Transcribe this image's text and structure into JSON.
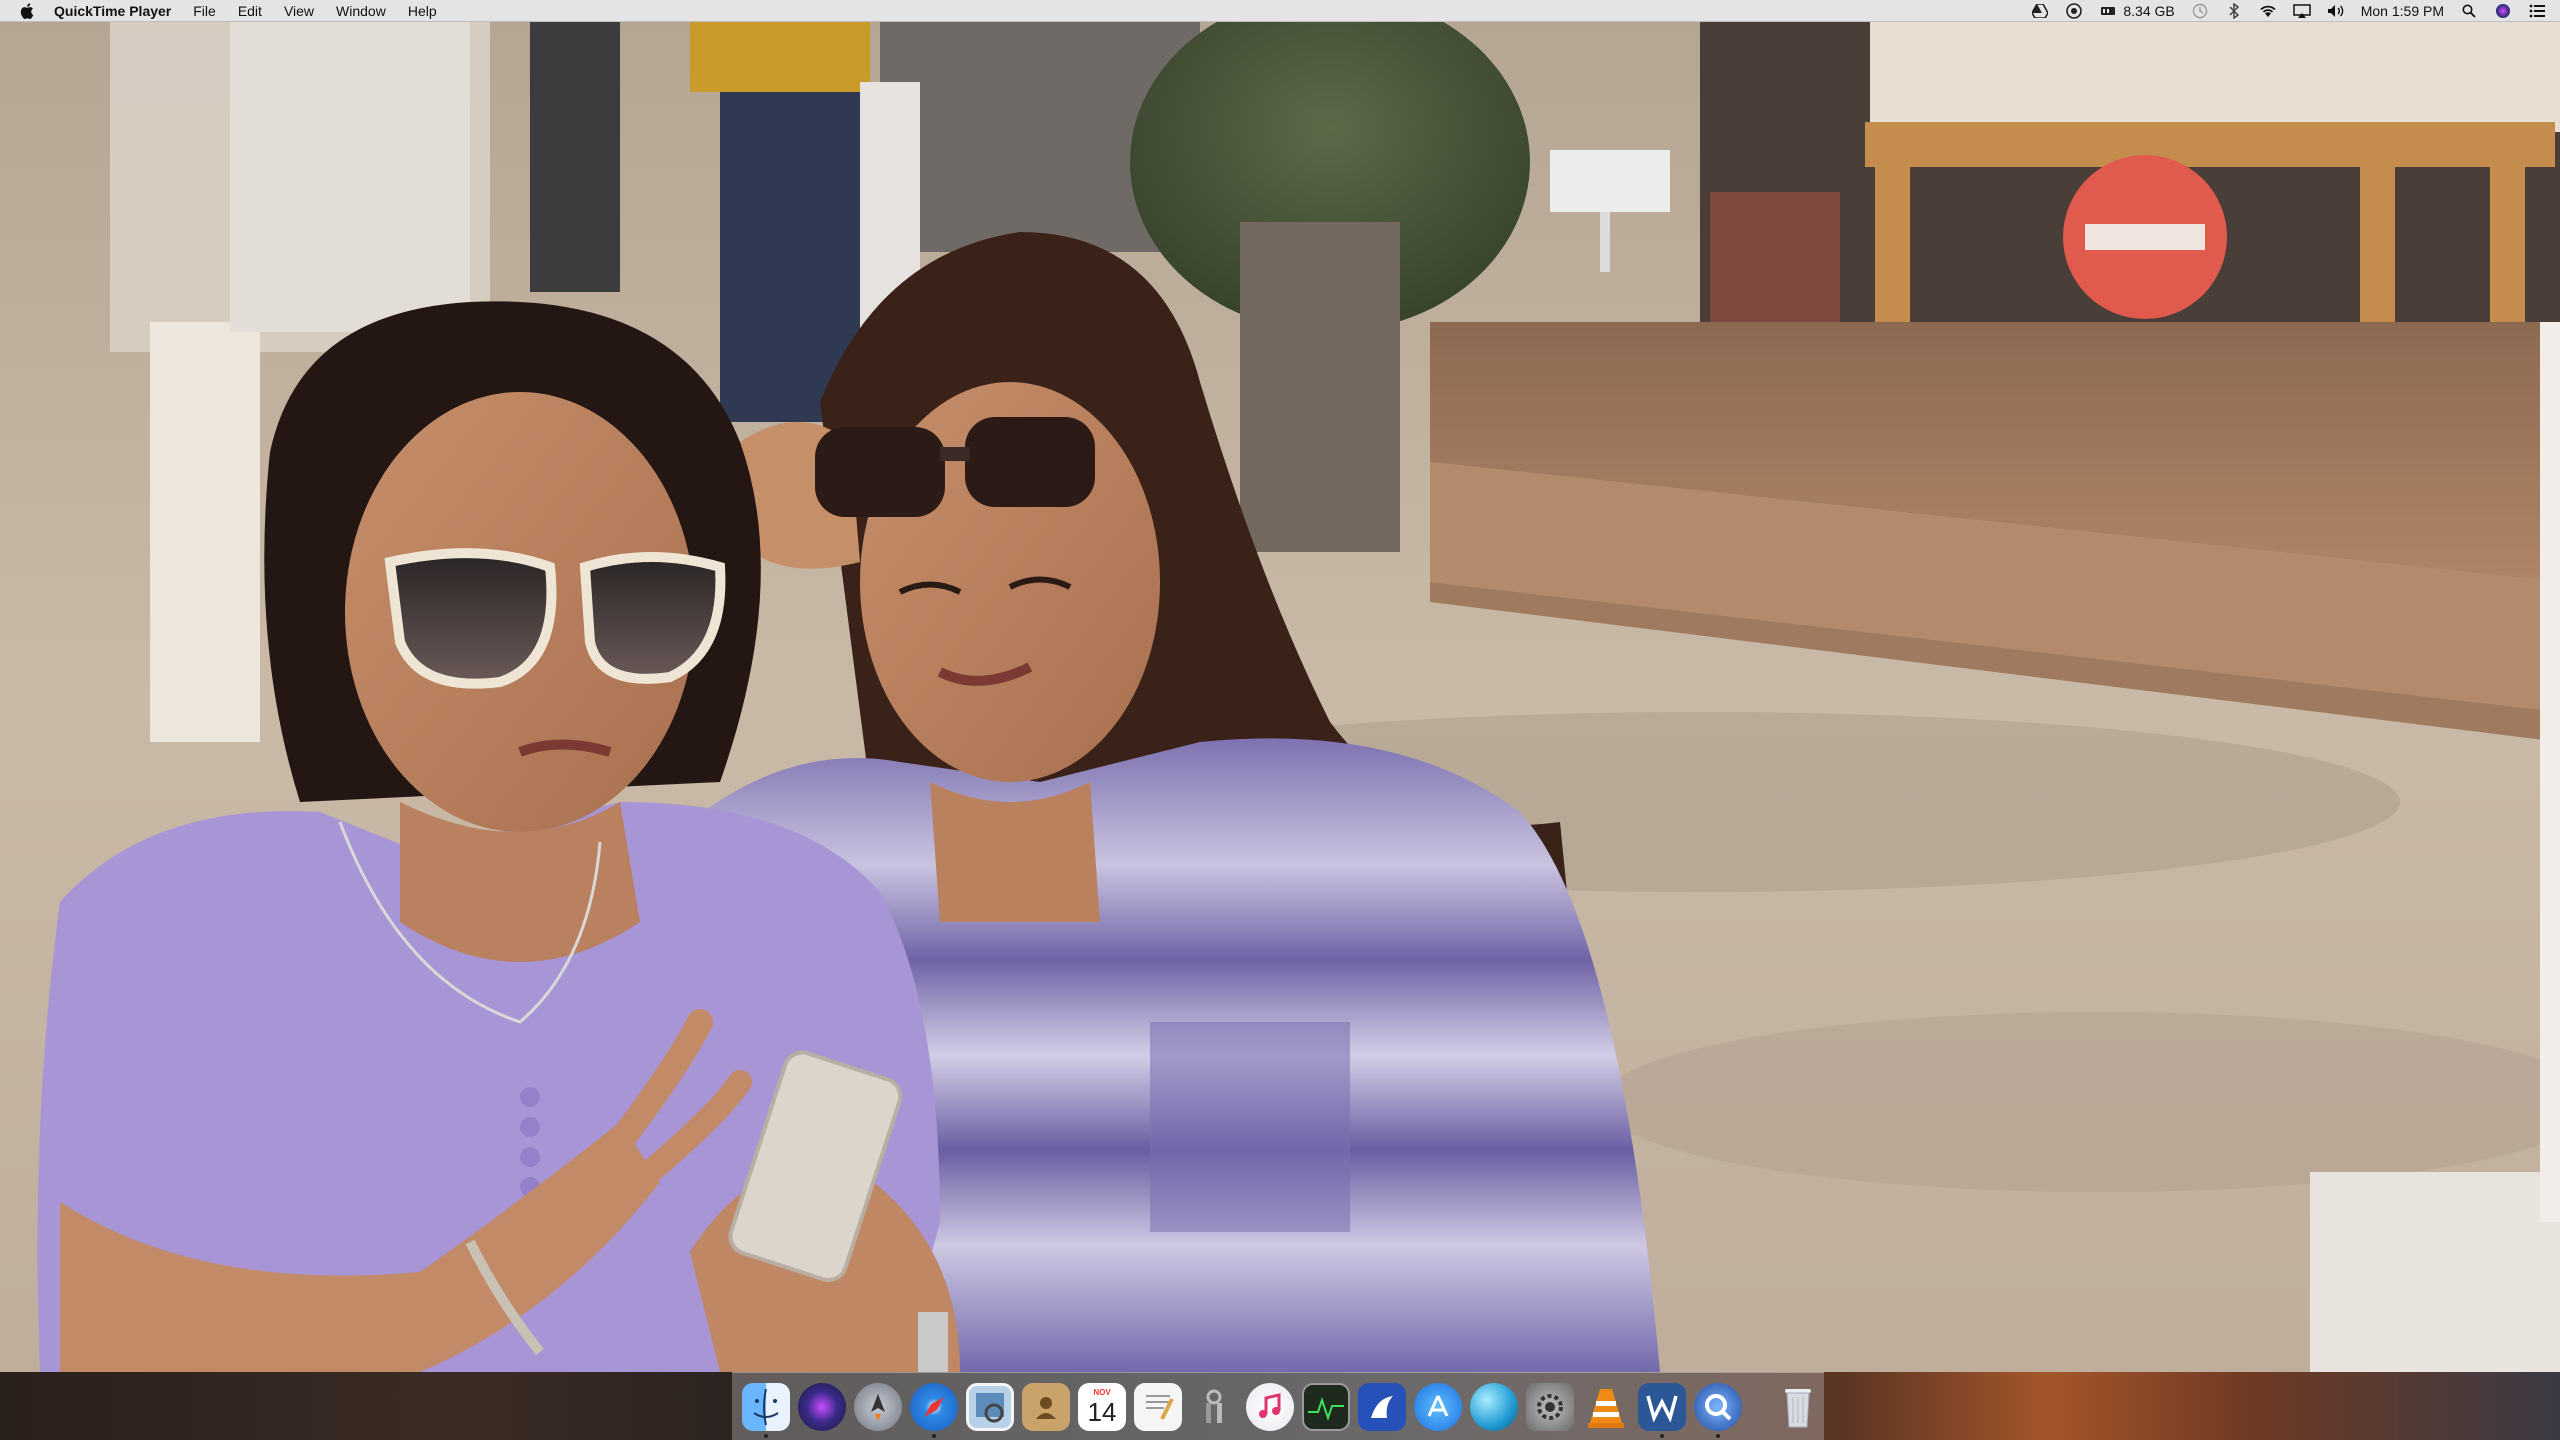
{
  "menubar": {
    "app_name": "QuickTime Player",
    "menus": [
      "File",
      "Edit",
      "View",
      "Window",
      "Help"
    ],
    "status": {
      "storage": "8.34 GB",
      "clock": "Mon 1:59 PM"
    },
    "icons": [
      "apple-icon",
      "google-drive-icon",
      "app-status-icon",
      "memory-icon",
      "time-machine-icon",
      "bluetooth-icon",
      "wifi-icon",
      "airplay-icon",
      "volume-icon",
      "spotlight-icon",
      "siri-icon",
      "notification-center-icon"
    ]
  },
  "calendar_icon": {
    "month": "NOV",
    "day": "14"
  },
  "dock": {
    "apps": [
      {
        "name": "finder",
        "color": "#3d8ff5",
        "running": true
      },
      {
        "name": "siri",
        "color": "#2b2b55",
        "running": false
      },
      {
        "name": "launchpad",
        "color": "#9aa0aa",
        "running": false
      },
      {
        "name": "safari",
        "color": "#2f8ae6",
        "running": true
      },
      {
        "name": "preview",
        "color": "#88b4d8",
        "running": false
      },
      {
        "name": "contacts",
        "color": "#c9a36a",
        "running": false
      },
      {
        "name": "calendar",
        "color": "#ffffff",
        "running": false
      },
      {
        "name": "textedit",
        "color": "#f2f2f2",
        "running": false
      },
      {
        "name": "keychain",
        "color": "#cfcfcf",
        "running": false
      },
      {
        "name": "itunes",
        "color": "#f0f0f0",
        "running": false
      },
      {
        "name": "activity-monitor",
        "color": "#1f2a1f",
        "running": false
      },
      {
        "name": "media-app",
        "color": "#2551b8",
        "running": false
      },
      {
        "name": "app-store",
        "color": "#1c8cf0",
        "running": false
      },
      {
        "name": "sphere-app",
        "color": "#27a6d8",
        "running": false
      },
      {
        "name": "system-preferences",
        "color": "#8c8c8c",
        "running": false
      },
      {
        "name": "vlc",
        "color": "#f08a16",
        "running": false
      },
      {
        "name": "word",
        "color": "#2b5797",
        "running": true
      },
      {
        "name": "quicktime",
        "color": "#1f4aa0",
        "running": true
      },
      {
        "name": "trash",
        "color": "#d8dbe0",
        "running": false
      }
    ]
  }
}
